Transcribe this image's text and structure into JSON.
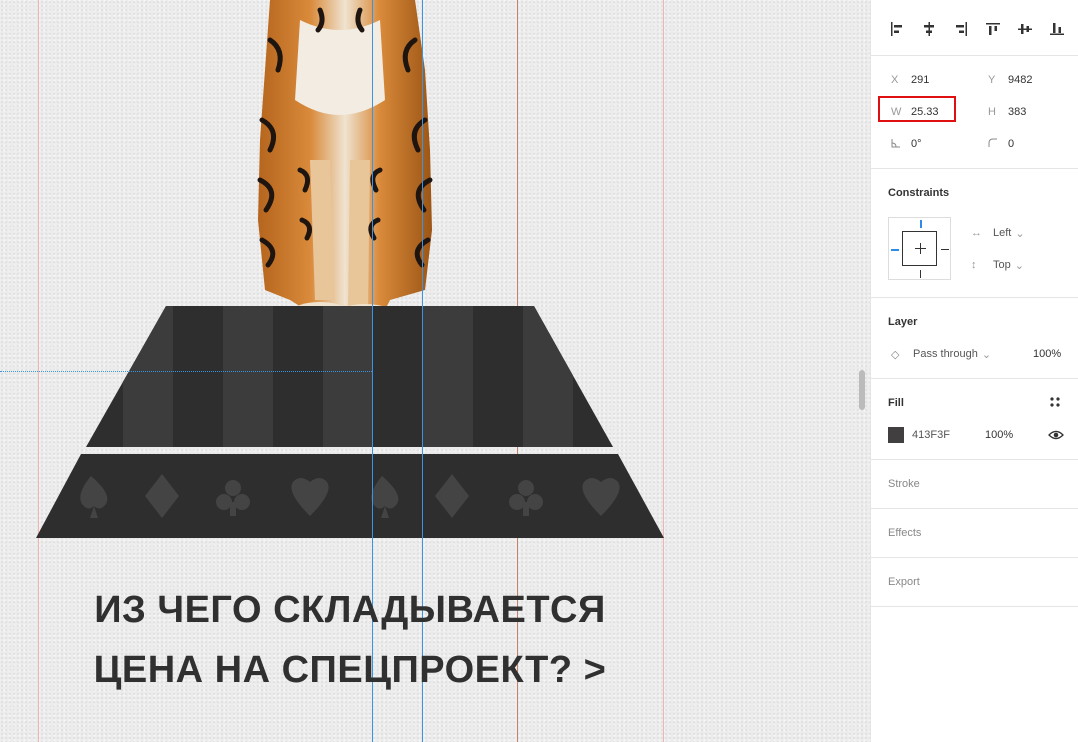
{
  "headline": {
    "line1": "ИЗ ЧЕГО СКЛАДЫВАЕТСЯ",
    "line2": "ЦЕНА НА СПЕЦПРОЕКТ? >"
  },
  "panel": {
    "position": {
      "x_label": "X",
      "x_value": "291",
      "y_label": "Y",
      "y_value": "9482",
      "w_label": "W",
      "w_value": "25.33",
      "h_label": "H",
      "h_value": "383",
      "rotation_value": "0°",
      "radius_value": "0"
    },
    "constraints": {
      "title": "Constraints",
      "horizontal": "Left",
      "vertical": "Top"
    },
    "layer": {
      "title": "Layer",
      "blend_mode": "Pass through",
      "opacity": "100%"
    },
    "fill": {
      "title": "Fill",
      "hex": "413F3F",
      "opacity": "100%",
      "color": "#413f3f"
    },
    "stroke": {
      "title": "Stroke"
    },
    "effects": {
      "title": "Effects"
    },
    "export": {
      "title": "Export"
    }
  },
  "colors": {
    "pedestal_dark": "#2e2e2e",
    "pedestal_stripe": "#3d3c3c",
    "guide_blue": "#3b93e6",
    "guide_red": "#f2b5ad",
    "highlight": "#e01010"
  }
}
